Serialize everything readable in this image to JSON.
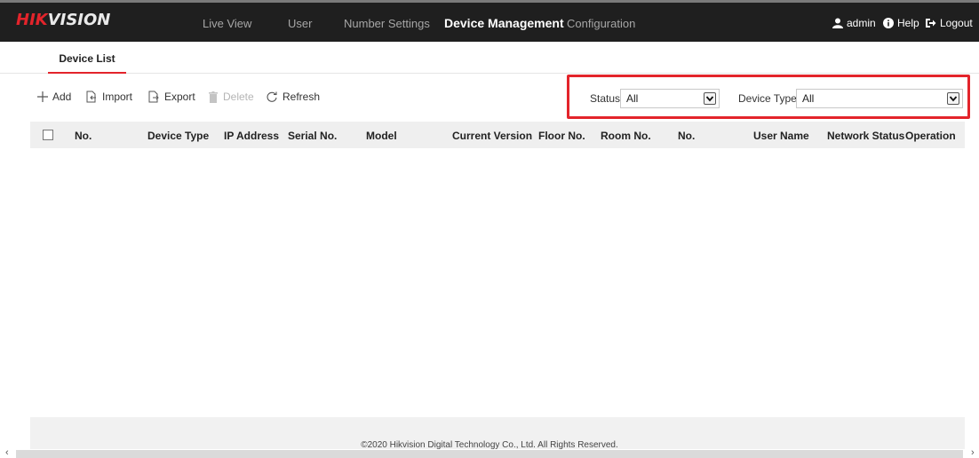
{
  "brand": {
    "logo_hik": "HIK",
    "logo_vision": "VISION"
  },
  "nav": {
    "items": [
      {
        "label": "Live View"
      },
      {
        "label": "User"
      },
      {
        "label": "Number Settings"
      },
      {
        "label": "Device Management"
      },
      {
        "label": "Configuration"
      }
    ],
    "active": "Device Management"
  },
  "utils": {
    "user": "admin",
    "help": "Help",
    "logout": "Logout"
  },
  "subtabs": {
    "device_list": "Device List"
  },
  "toolbar": {
    "add": "Add",
    "import": "Import",
    "export": "Export",
    "delete": "Delete",
    "refresh": "Refresh"
  },
  "filters": {
    "status_label": "Status",
    "status_value": "All",
    "device_type_label": "Device Type",
    "device_type_value": "All"
  },
  "table": {
    "columns": [
      "No.",
      "Device Type",
      "IP Address",
      "Serial No.",
      "Model",
      "Current Version",
      "Floor No.",
      "Room No.",
      "No.",
      "User Name",
      "Network Status",
      "Operation"
    ],
    "rows": []
  },
  "footer": {
    "copyright": "©2020 Hikvision Digital Technology Co., Ltd. All Rights Reserved."
  },
  "colors": {
    "accent": "#e3242b",
    "topbar": "#1f1f1f",
    "header_row": "#efefef"
  },
  "icons": [
    "user-icon",
    "help-icon",
    "logout-icon",
    "plus-icon",
    "import-icon",
    "export-icon",
    "trash-icon",
    "refresh-icon",
    "chevron-down-icon"
  ]
}
